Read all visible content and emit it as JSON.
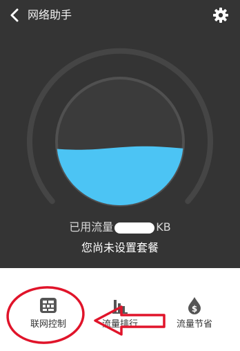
{
  "header": {
    "title": "网络助手"
  },
  "gauge": {
    "fill_fraction": 0.45
  },
  "usage": {
    "label": "已用流量",
    "unit": "KB"
  },
  "status": {
    "text": "您尚未设置套餐"
  },
  "bottom_nav": [
    {
      "label": "联网控制",
      "icon": "grid-icon"
    },
    {
      "label": "流量排行",
      "icon": "bar-chart-icon"
    },
    {
      "label": "流量节省",
      "icon": "dollar-drop-icon"
    }
  ],
  "colors": {
    "background": "#343434",
    "water_light": "#4cc4f4",
    "water_dark": "#2aa0e6",
    "annotation": "#e0142a"
  }
}
